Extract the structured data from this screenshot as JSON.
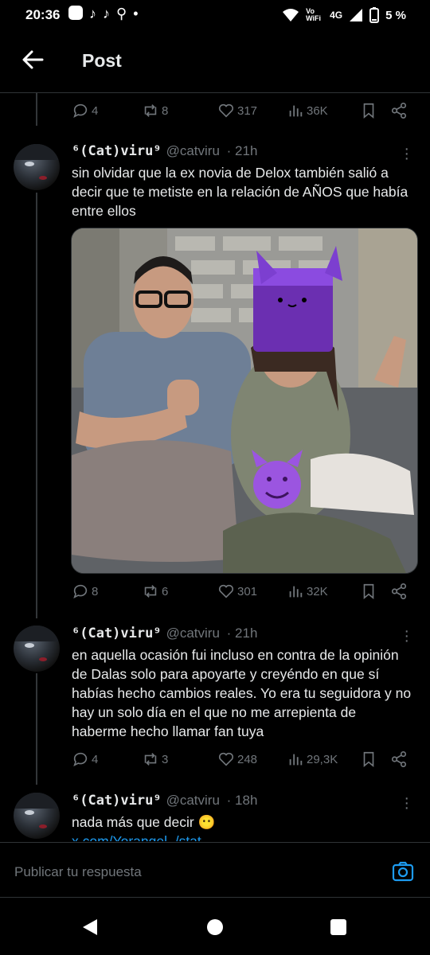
{
  "status": {
    "time": "20:36",
    "network": "4G",
    "vowifi": "Vo WiFi",
    "battery": "5 %"
  },
  "appbar": {
    "title": "Post"
  },
  "colors": {
    "accent": "#1d9bf0",
    "muted": "#71767b",
    "text": "#e7e9ea",
    "bg": "#000000"
  },
  "top_actions": {
    "replies": "4",
    "reposts": "8",
    "likes": "317",
    "views": "36K"
  },
  "tweets": [
    {
      "name": "⁶(Cat)viru⁹",
      "handle": "@catviru",
      "time": "· 21h",
      "text": "sin olvidar que la ex novia de Delox también salió a decir que te metiste en la relación de AÑOS que había entre ellos",
      "actions": {
        "replies": "8",
        "reposts": "6",
        "likes": "301",
        "views": "32K"
      }
    },
    {
      "name": "⁶(Cat)viru⁹",
      "handle": "@catviru",
      "time": "· 21h",
      "text": "en aquella ocasión fui incluso en contra de la opinión de Dalas solo para apoyarte y creyéndo en que sí habías hecho cambios reales. Yo era tu seguidora y no hay un solo día en el que no me arrepienta de haberme hecho llamar fan tuya",
      "actions": {
        "replies": "4",
        "reposts": "3",
        "likes": "248",
        "views": "29,3K"
      }
    },
    {
      "name": "⁶(Cat)viru⁹",
      "handle": "@catviru",
      "time": "· 18h",
      "text": "nada más que decir",
      "emoji": "😶",
      "link": "x.com/Yorangel_/stat..."
    }
  ],
  "reply": {
    "placeholder": "Publicar tu respuesta"
  }
}
